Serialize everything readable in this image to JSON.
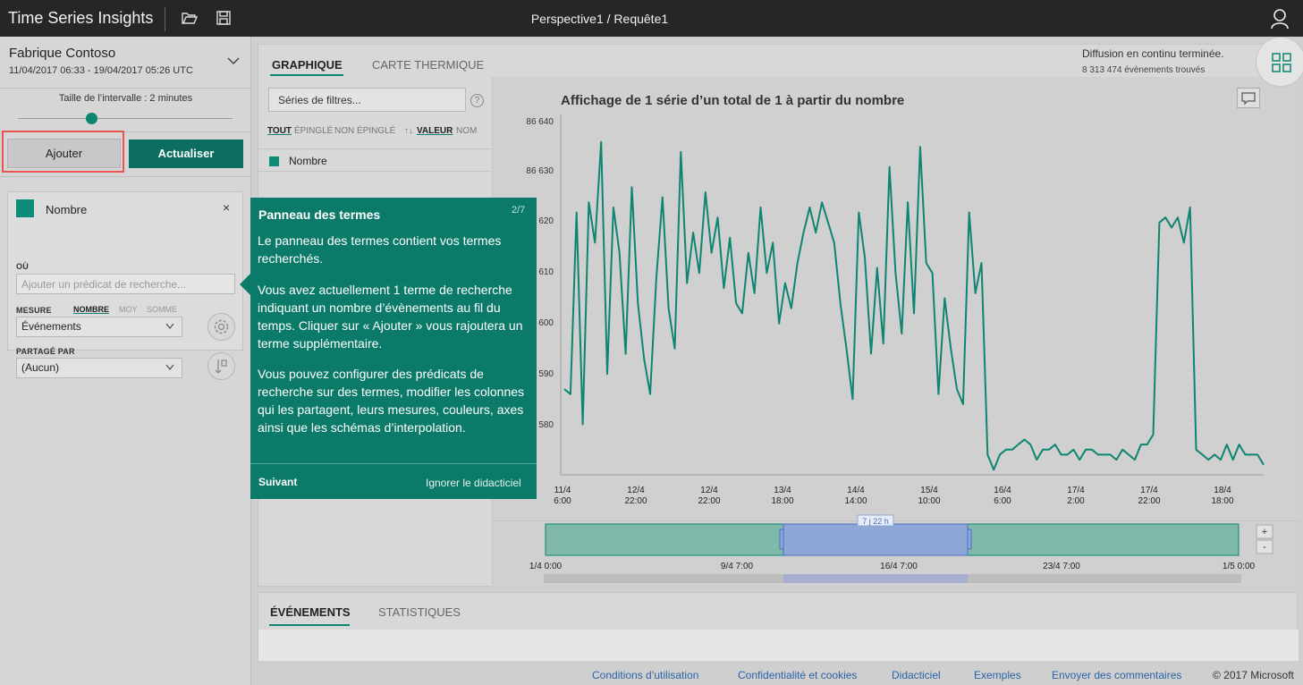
{
  "app": {
    "title": "Time Series Insights",
    "breadcrumb": "Perspective1 / Requête1"
  },
  "environment": {
    "name": "Fabrique Contoso",
    "range": "11/04/2017 06:33  -  19/04/2017 05:26 UTC"
  },
  "interval": {
    "label": "Taille de l’intervalle : 2 minutes",
    "value": 0.35
  },
  "buttons": {
    "add": "Ajouter",
    "refresh": "Actualiser"
  },
  "term": {
    "name": "Nombre",
    "close": "×",
    "where_label": "OÙ",
    "where_placeholder": "Ajouter un prédicat de recherche...",
    "measure_label": "MESURE",
    "measure_options": [
      "NOMBRE",
      "MOY",
      "SOMME"
    ],
    "measure_selected": "Événements",
    "split_label": "PARTAGÉ PAR",
    "split_selected": "(Aucun)"
  },
  "main": {
    "tabs": [
      "GRAPHIQUE",
      "CARTE THERMIQUE"
    ],
    "status": "Diffusion en continu terminée.",
    "event_count": "8 313 474 évènements trouvés",
    "filter_placeholder": "Séries de filtres...",
    "help": "?",
    "filter_tabs": [
      "TOUT",
      "ÉPINGLÉ",
      "NON ÉPINGLÉ",
      "↑↓",
      "VALEUR",
      "NOM"
    ],
    "series_name": "Nombre"
  },
  "chart_data": {
    "type": "line",
    "title": "Affichage de 1 série d’un total de 1 à partir du nombre",
    "y_ticks": [
      "86 640",
      "86 630",
      "620",
      "610",
      "600",
      "590",
      "580"
    ],
    "x_ticks": [
      [
        "11/4",
        "6:00"
      ],
      [
        "12/4",
        "22:00"
      ],
      [
        "12/4",
        "22:00"
      ],
      [
        "13/4",
        "18:00"
      ],
      [
        "14/4",
        "14:00"
      ],
      [
        "15/4",
        "10:00"
      ],
      [
        "16/4",
        "6:00"
      ],
      [
        "17/4",
        "2:00"
      ],
      [
        "17/4",
        "22:00"
      ],
      [
        "18/4",
        "18:00"
      ]
    ],
    "ylim": [
      86572,
      86642
    ],
    "series": [
      {
        "name": "Nombre",
        "color": "#0d8572",
        "values": [
          86589,
          86588,
          86624,
          86582,
          86626,
          86618,
          86638,
          86592,
          86625,
          86616,
          86596,
          86629,
          86606,
          86595,
          86588,
          86611,
          86627,
          86605,
          86597,
          86636,
          86610,
          86620,
          86612,
          86628,
          86616,
          86623,
          86609,
          86619,
          86606,
          86604,
          86616,
          86608,
          86625,
          86612,
          86618,
          86602,
          86610,
          86605,
          86614,
          86620,
          86625,
          86620,
          86626,
          86622,
          86618,
          86606,
          86597,
          86587,
          86624,
          86615,
          86596,
          86613,
          86598,
          86633,
          86612,
          86600,
          86626,
          86604,
          86637,
          86614,
          86612,
          86588,
          86607,
          86597,
          86589,
          86586,
          86624,
          86608,
          86614,
          86576,
          86573,
          86576,
          86577,
          86577,
          86578,
          86579,
          86578,
          86575,
          86577,
          86577,
          86578,
          86576,
          86576,
          86577,
          86575,
          86577,
          86577,
          86576,
          86576,
          86576,
          86575,
          86577,
          86576,
          86575,
          86578,
          86578,
          86580,
          86622,
          86623,
          86621,
          86623,
          86618,
          86625,
          86577,
          86576,
          86575,
          86576,
          86575,
          86578,
          86575,
          86578,
          86576,
          86576,
          86576,
          86574
        ]
      }
    ],
    "brush": {
      "label": "7 j 22 h",
      "ticks": [
        "1/4 0:00",
        "9/4 7:00",
        "16/4 7:00",
        "23/4 7:00",
        "1/5 0:00"
      ],
      "zoom_in": "+",
      "zoom_out": "-"
    }
  },
  "bottom": {
    "tabs": [
      "ÉVÉNEMENTS",
      "STATISTIQUES"
    ]
  },
  "footer": {
    "links": [
      "Conditions d’utilisation",
      "Confidentialité et cookies",
      "Didacticiel",
      "Exemples",
      "Envoyer des commentaires"
    ],
    "copyright": "© 2017 Microsoft"
  },
  "tutorial": {
    "title": "Panneau des termes",
    "step": "2/7",
    "p1": "Le panneau des termes contient vos termes recherchés.",
    "p2": "Vous avez actuellement 1 terme de recherche indiquant un nombre d’évènements au fil du temps. Cliquer sur « Ajouter » vous rajoutera un terme supplémentaire.",
    "p3": "Vous pouvez configurer des prédicats de recherche sur des termes, modifier les colonnes qui les partagent, leurs mesures, couleurs, axes ainsi que les schémas d’interpolation.",
    "next": "Suivant",
    "skip": "Ignorer le didacticiel"
  },
  "icons": {
    "open": "folder-open-icon",
    "save": "save-icon",
    "user": "user-icon",
    "layout": "grid-layout-icon",
    "comment": "comment-icon",
    "settings": "gear-icon",
    "split": "split-icon"
  },
  "colors": {
    "accent": "#0d8572",
    "topbar": "#262626",
    "tutorial": "#0b7a69",
    "add_highlight": "#e8554e"
  }
}
